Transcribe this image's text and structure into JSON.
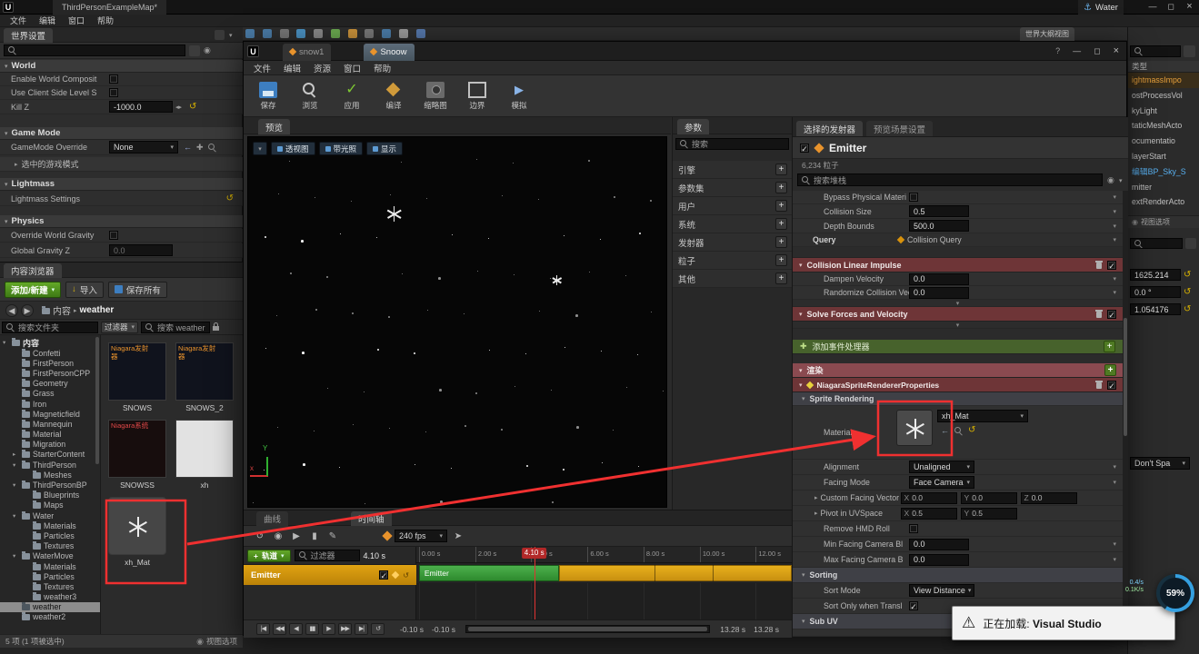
{
  "titlebar": {
    "title": "ThirdPersonExampleMap*",
    "water": "Water"
  },
  "menus": {
    "main": [
      "文件",
      "编辑",
      "窗口",
      "帮助"
    ],
    "niagara": [
      "文件",
      "编辑",
      "资源",
      "窗口",
      "帮助"
    ]
  },
  "world_settings": {
    "tab": "世界设置",
    "sec_world": "World",
    "enable_world_composition": "Enable World Composit",
    "use_client_side_level": "Use Client Side Level S",
    "kill_z": "Kill Z",
    "kill_z_value": "-1000.0",
    "sec_game_mode": "Game Mode",
    "gamemode_override": "GameMode Override",
    "gamemode_value": "None",
    "selected_game_mode": "选中的游戏模式",
    "sec_lightmass": "Lightmass",
    "lightmass_settings": "Lightmass Settings",
    "sec_physics": "Physics",
    "override_world_gravity": "Override World Gravity",
    "global_gravity_z": "Global Gravity Z",
    "global_gravity_value": "0.0"
  },
  "content_browser": {
    "tab": "内容浏览器",
    "add_new": "添加/新建",
    "import": "导入",
    "save_all": "保存所有",
    "path_root": "内容",
    "path_current": "weather",
    "search_folders": "搜索文件夹",
    "filter": "过滤器",
    "search_assets": "搜索 weather",
    "tree_root": "内容",
    "tree": [
      {
        "label": "Confetti",
        "cls": "i1",
        "arr": ""
      },
      {
        "label": "FirstPerson",
        "cls": "i1",
        "arr": ""
      },
      {
        "label": "FirstPersonCPP",
        "cls": "i1",
        "arr": ""
      },
      {
        "label": "Geometry",
        "cls": "i1",
        "arr": ""
      },
      {
        "label": "Grass",
        "cls": "i1",
        "arr": ""
      },
      {
        "label": "Iron",
        "cls": "i1",
        "arr": ""
      },
      {
        "label": "Magneticfield",
        "cls": "i1",
        "arr": ""
      },
      {
        "label": "Mannequin",
        "cls": "i1",
        "arr": ""
      },
      {
        "label": "Material",
        "cls": "i1",
        "arr": ""
      },
      {
        "label": "Migration",
        "cls": "i1",
        "arr": ""
      },
      {
        "label": "StarterContent",
        "cls": "i1",
        "arr": "▸"
      },
      {
        "label": "ThirdPerson",
        "cls": "i1",
        "arr": "▾"
      },
      {
        "label": "Meshes",
        "cls": "i2",
        "arr": ""
      },
      {
        "label": "ThirdPersonBP",
        "cls": "i1",
        "arr": "▾"
      },
      {
        "label": "Blueprints",
        "cls": "i2",
        "arr": ""
      },
      {
        "label": "Maps",
        "cls": "i2",
        "arr": ""
      },
      {
        "label": "Water",
        "cls": "i1",
        "arr": "▾"
      },
      {
        "label": "Materials",
        "cls": "i2",
        "arr": ""
      },
      {
        "label": "Particles",
        "cls": "i2",
        "arr": ""
      },
      {
        "label": "Textures",
        "cls": "i2",
        "arr": ""
      },
      {
        "label": "WaterMove",
        "cls": "i1",
        "arr": "▾"
      },
      {
        "label": "Materials",
        "cls": "i2",
        "arr": ""
      },
      {
        "label": "Particles",
        "cls": "i2",
        "arr": ""
      },
      {
        "label": "Textures",
        "cls": "i2",
        "arr": ""
      },
      {
        "label": "weather3",
        "cls": "i2",
        "arr": ""
      },
      {
        "label": "weather",
        "cls": "i1 sel",
        "arr": ""
      },
      {
        "label": "weather2",
        "cls": "i1",
        "arr": ""
      }
    ],
    "assets": [
      {
        "name": "SNOWS",
        "cls": "th-ne",
        "text": "Niagara发射器"
      },
      {
        "name": "SNOWS_2",
        "cls": "th-ne",
        "text": "Niagara发射器"
      },
      {
        "name": "SNOWSS",
        "cls": "th-ns",
        "text": "Niagara系统"
      },
      {
        "name": "xh",
        "cls": "th-tex",
        "text": ""
      },
      {
        "name": "xh_Mat",
        "cls": "th-mat",
        "text": ""
      }
    ],
    "status": "5 项 (1 项被选中)",
    "view_options": "视图选项"
  },
  "niagara": {
    "tabs": [
      {
        "label": "snow1",
        "cls": "off"
      },
      {
        "label": "Snoow",
        "cls": "on"
      }
    ],
    "toolbar": [
      {
        "label": "保存",
        "ic": "ic-save"
      },
      {
        "label": "浏览",
        "ic": "ic-browse"
      },
      {
        "label": "应用",
        "ic": "ic-apply"
      },
      {
        "label": "编译",
        "ic": "ic-compile"
      },
      {
        "label": "缩略图",
        "ic": "ic-thumb"
      },
      {
        "label": "边界",
        "ic": "ic-bounds"
      },
      {
        "label": "模拟",
        "ic": "ic-sim"
      }
    ],
    "preview_tab": "预览",
    "viewport_buttons": [
      "透视图",
      "带光照",
      "显示"
    ],
    "params_tab": "参数",
    "params_search": "搜索",
    "param_groups": [
      "引擎",
      "参数集",
      "用户",
      "系统",
      "发射器",
      "粒子",
      "其他"
    ],
    "right_tabs": [
      {
        "label": "选择的发射器",
        "cls": "on"
      },
      {
        "label": "预览场景设置",
        "cls": "off"
      }
    ],
    "emitter_name": "Emitter",
    "emitter_particles": "6,234 粒子",
    "stack_search": "搜索堆栈",
    "stack": {
      "bypass_physical": "Bypass Physical Materi",
      "collision_size": "Collision Size",
      "collision_size_value": "0.5",
      "depth_bounds": "Depth Bounds",
      "depth_bounds_value": "500.0",
      "query": "Query",
      "collision_query": "Collision Query",
      "collision_linear_impulse": "Collision Linear Impulse",
      "dampen_velocity": "Dampen Velocity",
      "dampen_velocity_value": "0.0",
      "randomize_collision": "Randomize Collision Vec",
      "randomize_collision_value": "0.0",
      "solve_forces": "Solve Forces and Velocity",
      "add_event_handler": "添加事件处理器",
      "render_section": "渲染",
      "sprite_renderer": "NiagaraSpriteRendererProperties",
      "sprite_rendering": "Sprite Rendering",
      "material_label": "Material",
      "material_value": "xh_Mat",
      "alignment_label": "Alignment",
      "alignment_value": "Unaligned",
      "facing_mode_label": "Facing Mode",
      "facing_mode_value": "Face Camera",
      "custom_facing_vector": "Custom Facing Vector",
      "axis_x": "X",
      "axis_y": "Y",
      "axis_z": "Z",
      "cfv_x": "0.0",
      "cfv_y": "0.0",
      "cfv_z": "0.0",
      "pivot_label": "Pivot in UVSpace",
      "pivot_x": "0.5",
      "pivot_y": "0.5",
      "remove_hmd_roll": "Remove HMD Roll",
      "min_facing": "Min Facing Camera Bl",
      "min_facing_value": "0.0",
      "max_facing": "Max Facing Camera B",
      "max_facing_value": "0.0",
      "sorting": "Sorting",
      "sort_mode_label": "Sort Mode",
      "sort_mode_value": "View Distance",
      "sort_only_translucent": "Sort Only when Transl",
      "sub_uv": "Sub UV"
    },
    "timeline": {
      "tabs": [
        {
          "label": "曲线",
          "cls": "off"
        },
        {
          "label": "时间轴",
          "cls": "on"
        }
      ],
      "fps": "240 fps",
      "add_track": "轨道",
      "filter_placeholder": "过滤器",
      "current_time": "4.10 s",
      "playhead_label": "4.10 s",
      "track_name": "Emitter",
      "bar_label": "Emitter",
      "ticks": [
        {
          "label": "0.00 s",
          "left": "0.7%"
        },
        {
          "label": "2.00 s",
          "left": "15.7%"
        },
        {
          "label": "4.00 s",
          "left": "30.6%"
        },
        {
          "label": "6.00 s",
          "left": "45.6%"
        },
        {
          "label": "8.00 s",
          "left": "60.5%"
        },
        {
          "label": "10.00 s",
          "left": "75.5%"
        },
        {
          "label": "12.00 s",
          "left": "90.4%"
        }
      ],
      "transport": [
        "|◀",
        "◀◀",
        "◀",
        "▮▮",
        "▶",
        "▶▶",
        "▶|",
        "↺"
      ],
      "range_start_a": "-0.10 s",
      "range_start_b": "-0.10 s",
      "range_end_a": "13.28 s",
      "range_end_b": "13.28 s"
    }
  },
  "outliner": {
    "tab": "世界大纲视图",
    "type_header": "类型",
    "items": [
      {
        "label": "ightmassImpo",
        "cls": "ol-sel"
      },
      {
        "label": "ostProcessVol",
        "cls": ""
      },
      {
        "label": "kyLight",
        "cls": ""
      },
      {
        "label": "taticMeshActo",
        "cls": ""
      },
      {
        "label": "ocumentatio",
        "cls": ""
      },
      {
        "label": "layerStart",
        "cls": ""
      },
      {
        "label": "编辑BP_Sky_S",
        "cls": "ol-link"
      },
      {
        "label": "mitter",
        "cls": ""
      },
      {
        "label": "extRenderActo",
        "cls": ""
      }
    ],
    "view_options": "视图选项"
  },
  "right_details": {
    "values": [
      "1625.214",
      "0.0 °",
      "1.054176"
    ],
    "dropdown": "Don't Spa"
  },
  "notification": {
    "prefix": "正在加载:",
    "app": "Visual Studio"
  },
  "progress": {
    "percent": "59%",
    "stat1": "0.4/s",
    "stat2": "0.1K/s"
  },
  "annotation": {
    "color": "#f03030"
  }
}
